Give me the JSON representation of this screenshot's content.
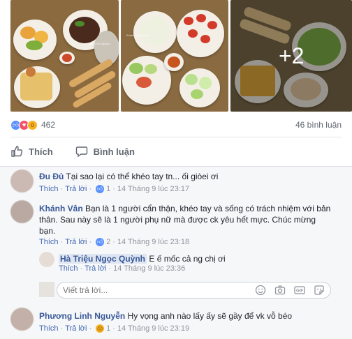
{
  "photos": {
    "more_count": "+2"
  },
  "stats": {
    "reaction_count": "462",
    "comment_count": "46 bình luận",
    "reactions": [
      "like",
      "love",
      "wow"
    ]
  },
  "actions": {
    "like_label": "Thích",
    "comment_label": "Bình luận"
  },
  "comments": [
    {
      "name": "Đu Đủ",
      "text": "Tại sao lại có thể khéo tay tn... ối giòei ơi",
      "like": "Thích",
      "reply": "Trả lời",
      "reaction_count": "1",
      "time": "14 Tháng 9 lúc 23:17"
    },
    {
      "name": "Khánh Vân",
      "text": "Bạn là 1 người cẩn thận, khéo tay và sống có trách nhiệm với bản thân. Sau này sẽ là 1 người phụ nữ mà được ck yêu hết mực. Chúc mừng bạn.",
      "like": "Thích",
      "reply": "Trả lời",
      "reaction_count": "2",
      "time": "14 Tháng 9 lúc 23:18"
    },
    {
      "name": "Hà Triệu Ngọc Quỳnh",
      "text": "E ế mốc cả ng chị ơi",
      "like": "Thích",
      "reply": "Trả lời",
      "time": "14 Tháng 9 lúc 23:36"
    },
    {
      "name": "Phương Linh Nguyễn",
      "text": "Hy vọng anh nào lấy ấy sẽ gầy để vk vỗ béo",
      "like": "Thích",
      "reply": "Trả lời",
      "reaction_count": "1",
      "time": "14 Tháng 9 lúc 23:19"
    }
  ],
  "reply_box": {
    "placeholder": "Viết trả lời..."
  },
  "colors": {
    "link": "#385898",
    "meta": "#90949c",
    "comment_bg": "#f6f7f9"
  }
}
